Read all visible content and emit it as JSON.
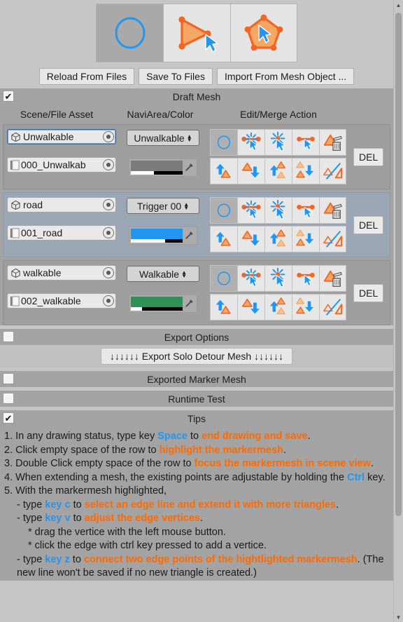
{
  "toolbar": {
    "modes": [
      {
        "name": "circle-draw-mode",
        "icon": "circle-icon",
        "active": true
      },
      {
        "name": "triangle-edit-mode",
        "icon": "triangle-cursor-icon",
        "active": false
      },
      {
        "name": "polygon-edit-mode",
        "icon": "pentagon-cursor-icon",
        "active": false
      }
    ],
    "reload_label": "Reload From Files",
    "save_label": "Save To Files",
    "import_label": "Import From Mesh Object ..."
  },
  "draft_mesh": {
    "title": "Draft Mesh",
    "checked": true,
    "columns": {
      "c1": "Scene/File Asset",
      "c2": "NaviArea/Color",
      "c3": "Edit/Merge Action"
    },
    "del_label": "DEL",
    "rows": [
      {
        "object_name": "Unwalkable",
        "file_name": "000_Unwalkab",
        "navi_area": "Unwalkable",
        "color": "#7b7b7b",
        "alpha_ratio": 0.45,
        "selected": false,
        "object_focused": true
      },
      {
        "object_name": "road",
        "file_name": "001_road",
        "navi_area": "Trigger 00",
        "color": "#2196f3",
        "alpha_ratio": 0.66,
        "selected": true,
        "object_focused": false
      },
      {
        "object_name": "walkable",
        "file_name": "002_walkable",
        "navi_area": "Walkable",
        "color": "#2e9158",
        "alpha_ratio": 0.22,
        "selected": false,
        "object_focused": false
      }
    ],
    "action_icons_top": [
      "draw-circle-icon",
      "split-edge-icon",
      "add-vertex-icon",
      "connect-points-icon",
      "delete-mesh-icon"
    ],
    "action_icons_bottom": [
      "merge-up-icon",
      "merge-down-icon",
      "merge-up-multi-icon",
      "merge-down-multi-icon",
      "unmerge-icon"
    ]
  },
  "export_options": {
    "title": "Export Options",
    "checked": false
  },
  "export_solo": {
    "label": "↓↓↓↓↓↓ Export Solo Detour Mesh ↓↓↓↓↓↓"
  },
  "exported_marker_mesh": {
    "title": "Exported Marker Mesh",
    "checked": false
  },
  "runtime_test": {
    "title": "Runtime Test",
    "checked": false
  },
  "tips": {
    "title": "Tips",
    "checked": true,
    "lines": [
      {
        "indent": 0,
        "parts": [
          {
            "t": "1. In any drawing status, type key "
          },
          {
            "t": "Space",
            "s": "k"
          },
          {
            "t": " to "
          },
          {
            "t": "end drawing and save",
            "s": "o"
          },
          {
            "t": "."
          }
        ]
      },
      {
        "indent": 0,
        "parts": [
          {
            "t": "2. Click empty space of the row to "
          },
          {
            "t": "highlight the markermesh",
            "s": "o"
          },
          {
            "t": "."
          }
        ]
      },
      {
        "indent": 0,
        "parts": [
          {
            "t": "3. Double Click empty space of the row to "
          },
          {
            "t": "focus the markermesh in scene view",
            "s": "o"
          },
          {
            "t": "."
          }
        ]
      },
      {
        "indent": 0,
        "parts": [
          {
            "t": "4. When extending a mesh, the existing points are adjustable by holding the "
          },
          {
            "t": "Ctrl",
            "s": "k"
          },
          {
            "t": " key."
          }
        ]
      },
      {
        "indent": 0,
        "parts": [
          {
            "t": "5. With the markermesh highlighted,"
          }
        ]
      },
      {
        "indent": 1,
        "parts": [
          {
            "t": "- type "
          },
          {
            "t": "key c",
            "s": "k"
          },
          {
            "t": " to "
          },
          {
            "t": "select an edge line and extend it with more triangles",
            "s": "o"
          },
          {
            "t": "."
          }
        ]
      },
      {
        "indent": 1,
        "parts": [
          {
            "t": "- type "
          },
          {
            "t": "key v",
            "s": "k"
          },
          {
            "t": " to "
          },
          {
            "t": "adjust the edge vertices",
            "s": "o"
          },
          {
            "t": "."
          }
        ]
      },
      {
        "indent": 2,
        "parts": [
          {
            "t": "* drag the vertice with the left mouse button."
          }
        ]
      },
      {
        "indent": 2,
        "parts": [
          {
            "t": "* click the edge with ctrl key pressed to add a vertice."
          }
        ]
      },
      {
        "indent": 1,
        "parts": [
          {
            "t": "- type "
          },
          {
            "t": "key z",
            "s": "k"
          },
          {
            "t": " to "
          },
          {
            "t": "connect two edge points of the hightlighted markermesh",
            "s": "o"
          },
          {
            "t": ". (The new line won't be saved if no new triangle is created.)"
          }
        ]
      }
    ]
  },
  "scrollbar": {
    "up": "▲",
    "down": "▼"
  }
}
